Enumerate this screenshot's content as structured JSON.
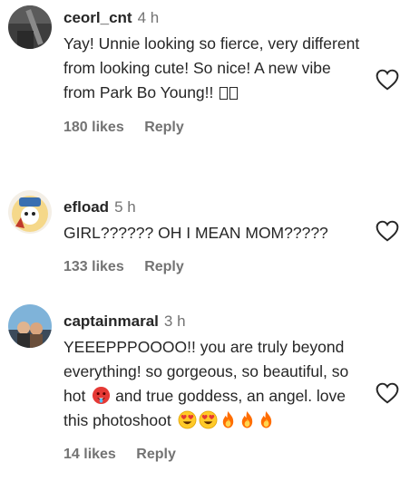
{
  "comments": [
    {
      "username": "ceorl_cnt",
      "time": "4 h",
      "text": "Yay! Unnie looking so fierce, very different from looking cute! So nice! A new vibe from Park Bo Young!!",
      "likes": "180 likes",
      "reply": "Reply"
    },
    {
      "username": "efload",
      "time": "5 h",
      "text": "GIRL?????? OH I MEAN MOM?????",
      "likes": "133 likes",
      "reply": "Reply"
    },
    {
      "username": "captainmaral",
      "time": "3 h",
      "text_part1": "YEEEPPPOOOO!! you are truly beyond everything! so gorgeous, so beautiful, so hot",
      "text_part2": "and true goddess, an angel. love this photoshoot",
      "likes": "14 likes",
      "reply": "Reply"
    }
  ],
  "icons": {
    "like": "heart-outline-icon",
    "hot_face": "hot-face-emoji",
    "heart_eyes": "heart-eyes-emoji",
    "fire": "fire-emoji"
  },
  "colors": {
    "text": "#262626",
    "secondary": "#737373"
  }
}
